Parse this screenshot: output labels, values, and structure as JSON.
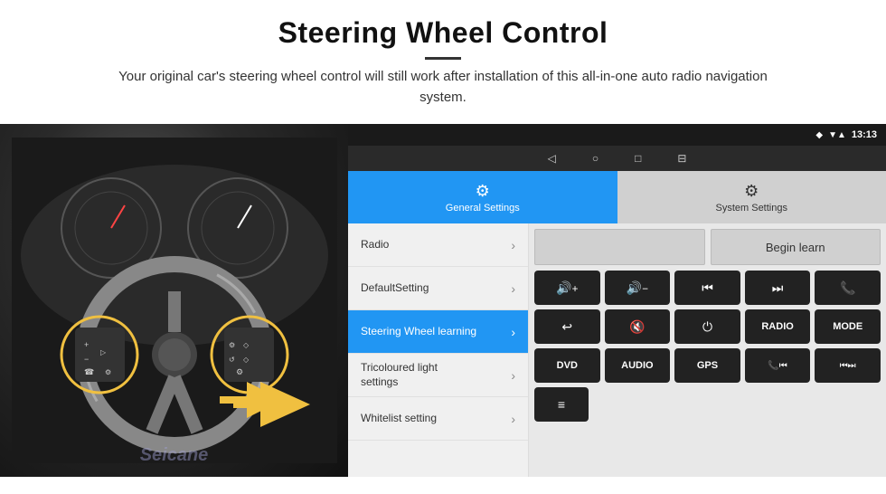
{
  "header": {
    "title": "Steering Wheel Control",
    "subtitle": "Your original car's steering wheel control will still work after installation of this all-in-one auto radio navigation system."
  },
  "statusbar": {
    "time": "13:13",
    "wifi_icon": "▼▲",
    "signal_icon": "◆"
  },
  "navbar": {
    "back_icon": "◁",
    "home_icon": "○",
    "recent_icon": "□",
    "menu_icon": "⊟"
  },
  "tabs": {
    "general": {
      "label": "General Settings",
      "icon": "⚙"
    },
    "system": {
      "label": "System Settings",
      "icon": "🔧"
    }
  },
  "menu": {
    "items": [
      {
        "label": "Radio",
        "active": false
      },
      {
        "label": "DefaultSetting",
        "active": false
      },
      {
        "label": "Steering Wheel learning",
        "active": true
      },
      {
        "label": "Tricoloured light settings",
        "active": false
      },
      {
        "label": "Whitelist setting",
        "active": false
      }
    ]
  },
  "content": {
    "begin_learn_label": "Begin learn",
    "controls_row1": [
      {
        "icon": "🔊+",
        "type": "icon"
      },
      {
        "icon": "🔊−",
        "type": "icon"
      },
      {
        "icon": "⏮",
        "type": "icon"
      },
      {
        "icon": "⏭",
        "type": "icon"
      },
      {
        "icon": "📞",
        "type": "icon"
      }
    ],
    "controls_row2": [
      {
        "icon": "↩",
        "type": "icon"
      },
      {
        "icon": "🔇",
        "type": "icon"
      },
      {
        "icon": "⏻",
        "type": "icon"
      },
      {
        "text": "RADIO",
        "type": "text"
      },
      {
        "text": "MODE",
        "type": "text"
      }
    ],
    "controls_row3": [
      {
        "text": "DVD",
        "type": "text"
      },
      {
        "text": "AUDIO",
        "type": "text"
      },
      {
        "text": "GPS",
        "type": "text"
      },
      {
        "icon": "📞⏮",
        "type": "icon"
      },
      {
        "icon": "⏮⏭",
        "type": "icon"
      }
    ],
    "controls_row4": [
      {
        "icon": "≡",
        "type": "icon"
      }
    ]
  },
  "watermark": "Seicane",
  "arrow": "➤"
}
